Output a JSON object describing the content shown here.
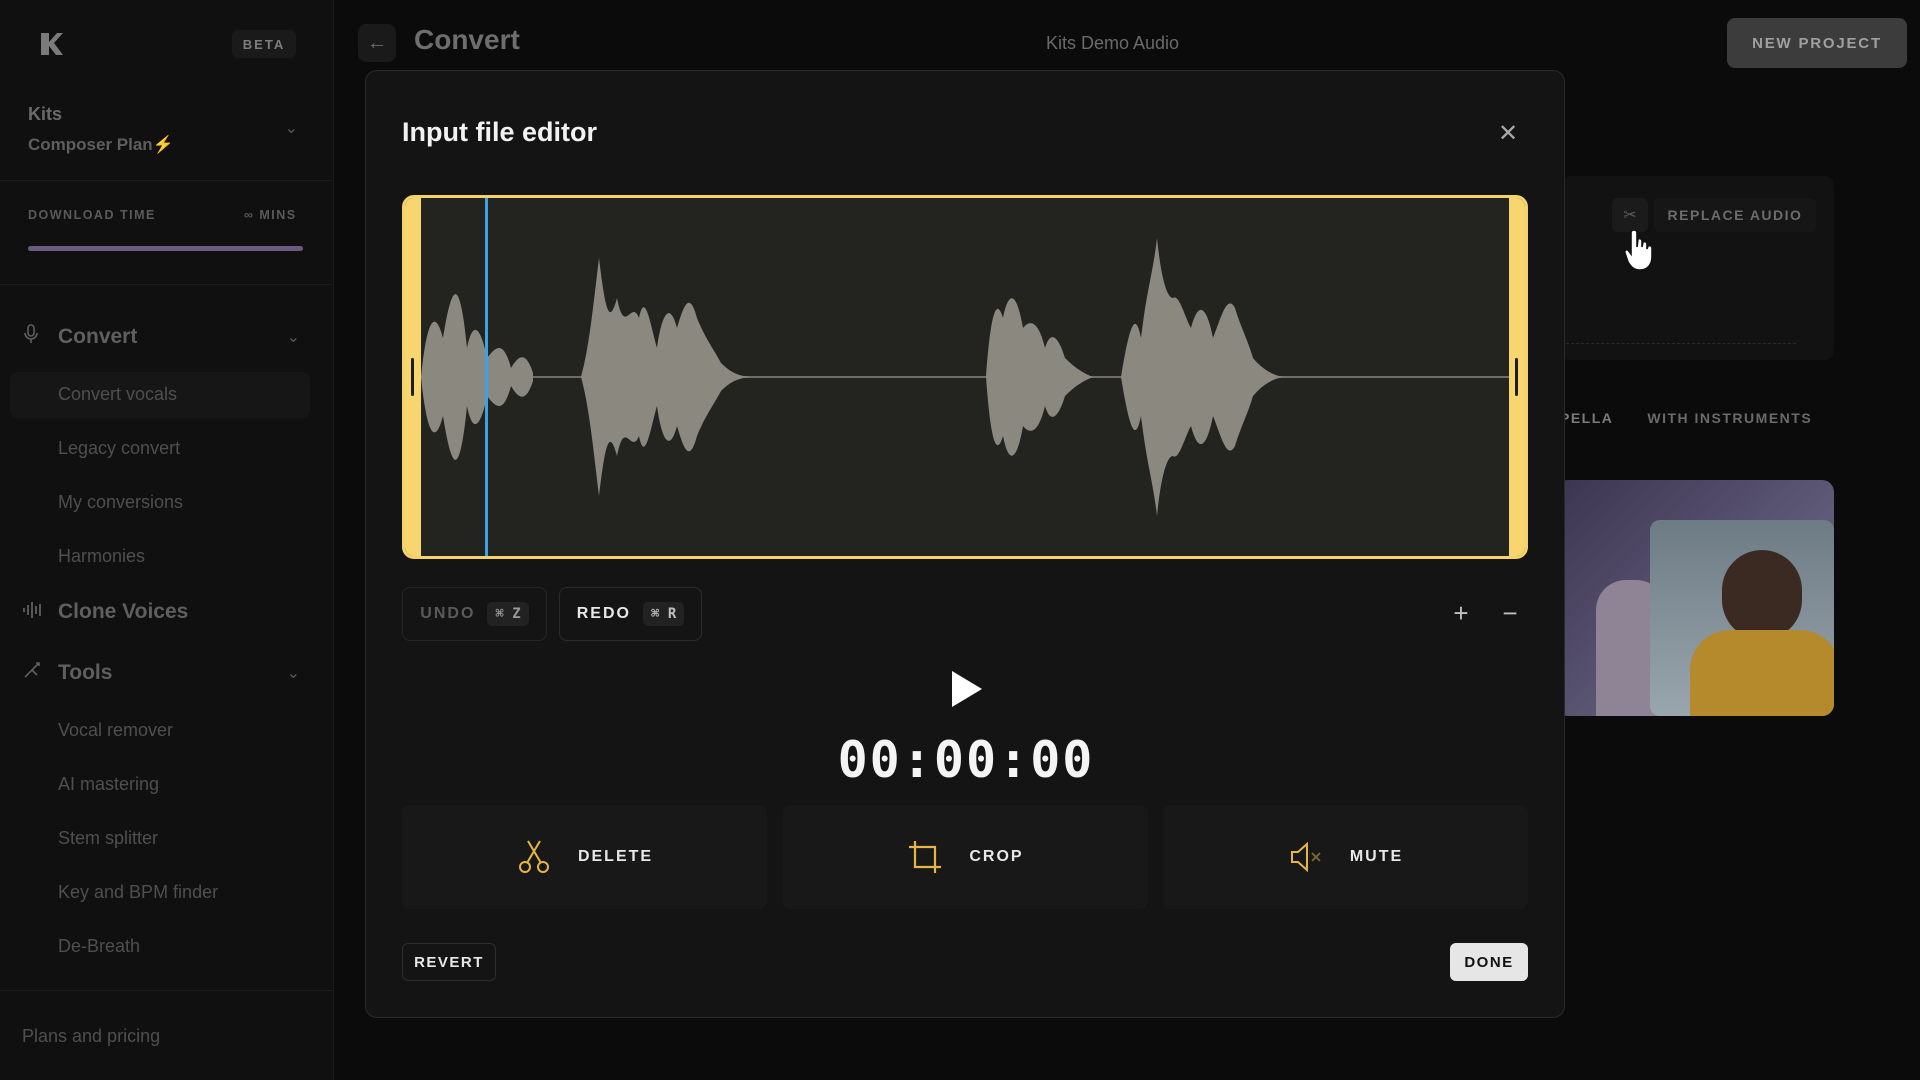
{
  "sidebar": {
    "beta": "BETA",
    "account": {
      "name": "Kits",
      "plan": "Composer Plan"
    },
    "download": {
      "label": "DOWNLOAD TIME",
      "value": "∞ MINS",
      "progress": 1.0
    },
    "sections": [
      {
        "label": "Convert",
        "icon": "microphone-icon",
        "items": [
          "Convert vocals",
          "Legacy convert",
          "My conversions",
          "Harmonies"
        ]
      },
      {
        "label": "Clone Voices",
        "icon": "waveform-icon",
        "items": []
      },
      {
        "label": "Tools",
        "icon": "tools-icon",
        "items": [
          "Vocal remover",
          "AI mastering",
          "Stem splitter",
          "Key and BPM finder",
          "De-Breath"
        ]
      }
    ],
    "plans": "Plans and pricing"
  },
  "topbar": {
    "title": "Convert",
    "project": "Kits Demo Audio",
    "new_project": "NEW PROJECT"
  },
  "background": {
    "replace_audio": "REPLACE AUDIO",
    "tab_a": "PELLA",
    "tab_b": "WITH INSTRUMENTS"
  },
  "modal": {
    "title": "Input file editor",
    "undo": {
      "label": "UNDO",
      "shortcut": "⌘ Z"
    },
    "redo": {
      "label": "REDO",
      "shortcut": "⌘ R"
    },
    "timecode": "00:00:00",
    "actions": {
      "delete": "DELETE",
      "crop": "CROP",
      "mute": "MUTE"
    },
    "revert": "REVERT",
    "done": "DONE"
  },
  "colors": {
    "accent": "#f4d36a",
    "playhead": "#3ea1e6",
    "icon_accent": "#e8b445"
  }
}
